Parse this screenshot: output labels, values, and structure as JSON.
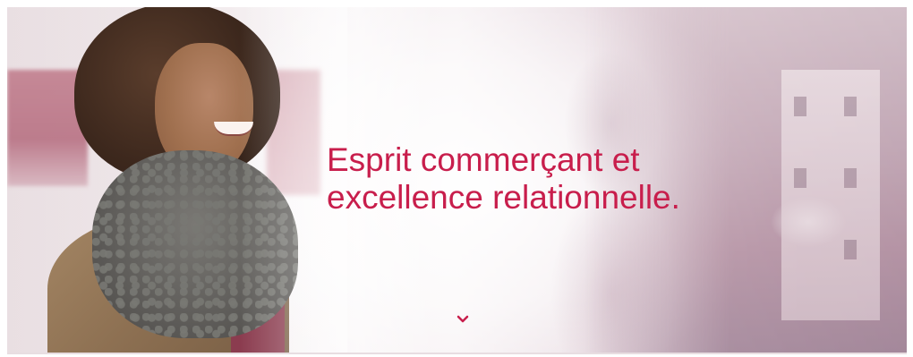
{
  "hero": {
    "headline_line1": "Esprit commerçant et",
    "headline_line2": "excellence relationnelle.",
    "scroll_icon": "chevron-down-icon"
  },
  "colors": {
    "accent": "#c81e4c",
    "background": "#ffffff"
  }
}
